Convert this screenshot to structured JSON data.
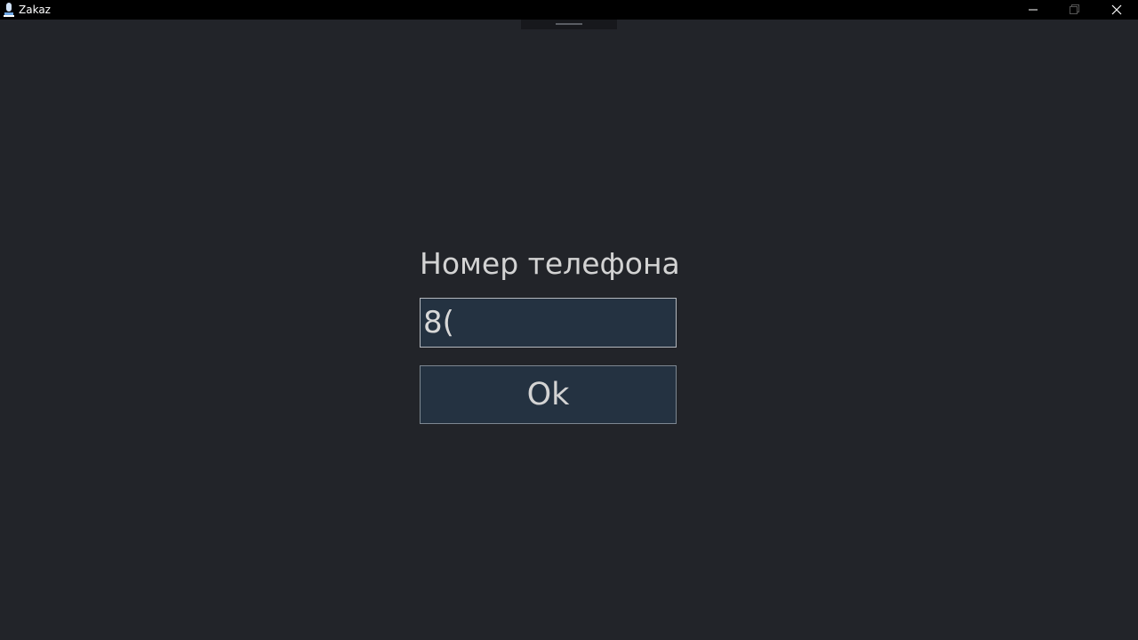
{
  "window": {
    "title": "Zakaz",
    "icons": [
      "app-icon",
      "minimize-icon",
      "maximize-icon",
      "close-icon"
    ]
  },
  "form": {
    "label": "Номер телефона",
    "phone_value": "8(",
    "ok_label": "Ok"
  },
  "colors": {
    "background": "#222429",
    "titlebar": "#000000",
    "control_fill": "#243241",
    "text": "#d3d3d3"
  }
}
